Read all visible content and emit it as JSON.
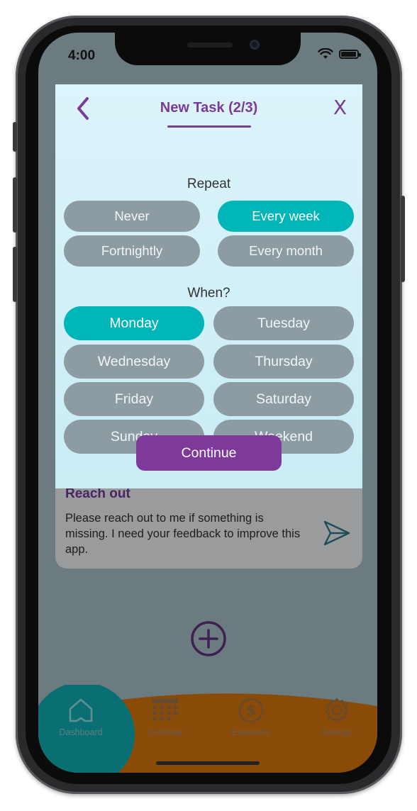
{
  "status_bar": {
    "time": "4:00"
  },
  "modal": {
    "title": "New Task (2/3)",
    "close_label": "X",
    "repeat_label": "Repeat",
    "repeat_options": [
      {
        "label": "Never",
        "selected": false
      },
      {
        "label": "Every week",
        "selected": true
      },
      {
        "label": "Fortnightly",
        "selected": false
      },
      {
        "label": "Every month",
        "selected": false
      }
    ],
    "when_label": "When?",
    "day_options": [
      {
        "label": "Monday",
        "selected": true
      },
      {
        "label": "Tuesday",
        "selected": false
      },
      {
        "label": "Wednesday",
        "selected": false
      },
      {
        "label": "Thursday",
        "selected": false
      },
      {
        "label": "Friday",
        "selected": false
      },
      {
        "label": "Saturday",
        "selected": false
      },
      {
        "label": "Sunday",
        "selected": false
      },
      {
        "label": "Weekend",
        "selected": false
      }
    ],
    "continue_label": "Continue"
  },
  "reach_out": {
    "title": "Reach out",
    "text": "Please reach out to me if something is missing. I need your feedback to improve this app."
  },
  "tab_bar": {
    "items": [
      {
        "label": "Dashboard",
        "icon": "home-icon",
        "active": true
      },
      {
        "label": "Calendar",
        "icon": "calendar-icon",
        "active": false
      },
      {
        "label": "Expenses",
        "icon": "dollar-icon",
        "active": false
      },
      {
        "label": "Settings",
        "icon": "gear-icon",
        "active": false
      }
    ]
  },
  "colors": {
    "accent_purple": "#7e3a9a",
    "selected_teal": "#00b5b8",
    "unselected_gray": "#8d9ca2",
    "tab_orange": "#c85c0a",
    "tab_teal": "#0a7c80"
  }
}
